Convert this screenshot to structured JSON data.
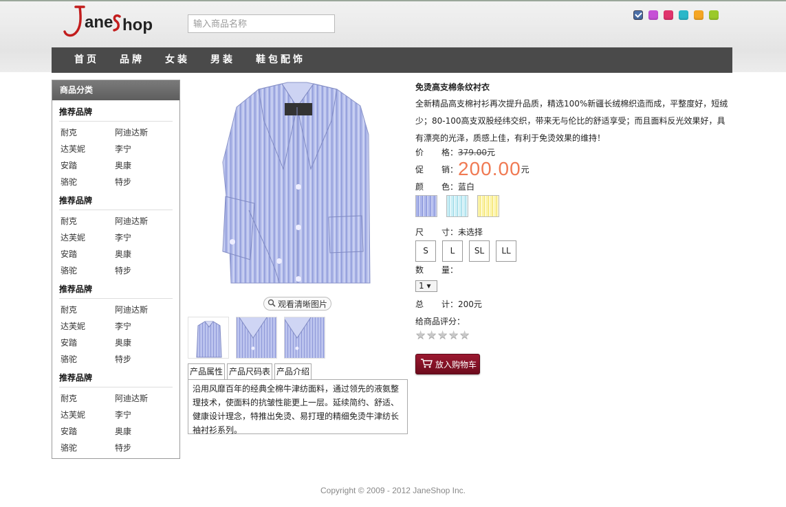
{
  "header": {
    "logo_text": "JaneShop",
    "search_placeholder": "输入商品名称",
    "theme_colors": [
      "#4b6fa8",
      "#c64fd6",
      "#e0336c",
      "#2ab7c9",
      "#f5a623",
      "#9bc92b"
    ],
    "selected_theme": "#4b6fa8"
  },
  "nav": {
    "items": [
      "首页",
      "品牌",
      "女装",
      "男装",
      "鞋包配饰"
    ]
  },
  "sidebar": {
    "title": "商品分类",
    "groups": [
      {
        "title": "推荐品牌",
        "brands": [
          "耐克",
          "阿迪达斯",
          "达芙妮",
          "李宁",
          "安踏",
          "奥康",
          "骆驼",
          "特步"
        ]
      },
      {
        "title": "推荐品牌",
        "brands": [
          "耐克",
          "阿迪达斯",
          "达芙妮",
          "李宁",
          "安踏",
          "奥康",
          "骆驼",
          "特步"
        ]
      },
      {
        "title": "推荐品牌",
        "brands": [
          "耐克",
          "阿迪达斯",
          "达芙妮",
          "李宁",
          "安踏",
          "奥康",
          "骆驼",
          "特步"
        ]
      },
      {
        "title": "推荐品牌",
        "brands": [
          "耐克",
          "阿迪达斯",
          "达芙妮",
          "李宁",
          "安踏",
          "奥康",
          "骆驼",
          "特步"
        ]
      }
    ]
  },
  "gallery": {
    "view_clear_label": "观看清晰图片",
    "thumb_count": 3
  },
  "tabs": {
    "items": [
      "产品属性",
      "产品尺码表",
      "产品介绍"
    ],
    "content": "沿用风靡百年的经典全棉牛津纺面料，通过领先的液氨整理技术，使面料的抗皱性能更上一层。延续简约、舒适、健康设计理念，特推出免烫、易打理的精细免烫牛津纺长袖衬衫系列。"
  },
  "product": {
    "title": "免烫高支棉条纹衬衣",
    "description": "全新精品高支棉衬衫再次提升品质，精选100%新疆长绒棉织造而成，平整度好，短绒少；80-100高支双股经纬交织，带来无与伦比的舒适享受；而且面料反光效果好，具有漂亮的光泽，质感上佳，有利于免烫效果的维持！",
    "price_label": [
      "价",
      "格："
    ],
    "price": "379.00",
    "promo_label": [
      "促",
      "销："
    ],
    "promo_price": "200.00",
    "currency": "元",
    "color_label": [
      "颜",
      "色："
    ],
    "color_value": "蓝白",
    "color_options": [
      "blue-stripe",
      "cyan-stripe",
      "yellow-stripe"
    ],
    "size_label": [
      "尺",
      "寸："
    ],
    "size_value": "未选择",
    "sizes": [
      "S",
      "L",
      "SL",
      "LL"
    ],
    "qty_label": [
      "数",
      "量："
    ],
    "qty_value": "1",
    "total_label": [
      "总",
      "计："
    ],
    "total_value": "200元",
    "rating_label": "给商品评分：",
    "rating": 0,
    "rating_max": 5,
    "cart_label": "放入购物车"
  },
  "footer": {
    "copyright": "Copyright © 2009 - 2012 JaneShop Inc."
  }
}
